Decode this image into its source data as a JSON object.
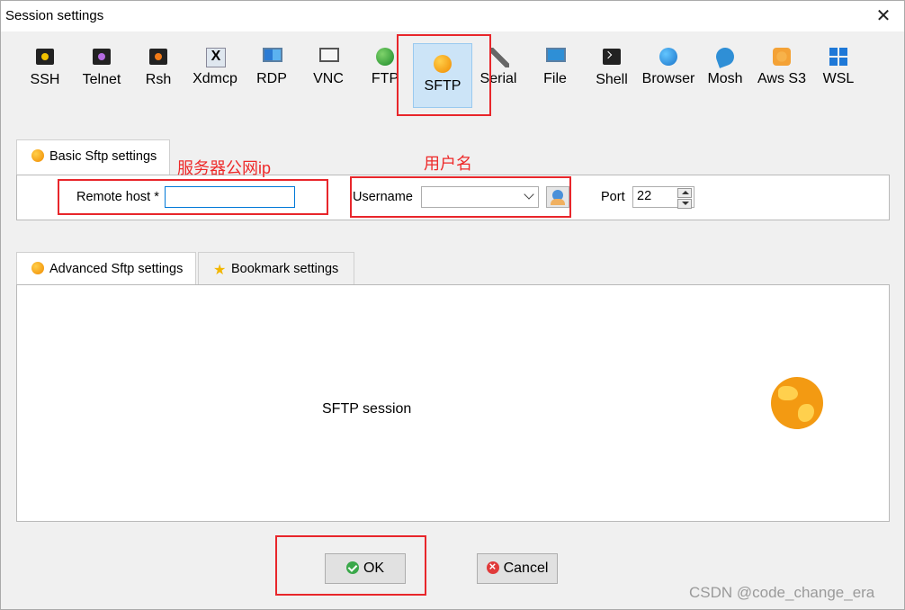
{
  "window": {
    "title": "Session settings",
    "close_symbol": "✕"
  },
  "protocols": [
    {
      "label": "SSH",
      "icon": "ssh-icon"
    },
    {
      "label": "Telnet",
      "icon": "telnet-icon"
    },
    {
      "label": "Rsh",
      "icon": "rsh-icon"
    },
    {
      "label": "Xdmcp",
      "icon": "xdmcp-icon"
    },
    {
      "label": "RDP",
      "icon": "rdp-icon"
    },
    {
      "label": "VNC",
      "icon": "vnc-icon"
    },
    {
      "label": "FTP",
      "icon": "ftp-icon"
    },
    {
      "label": "SFTP",
      "icon": "sftp-icon",
      "selected": true
    },
    {
      "label": "Serial",
      "icon": "serial-icon"
    },
    {
      "label": "File",
      "icon": "file-icon"
    },
    {
      "label": "Shell",
      "icon": "shell-icon"
    },
    {
      "label": "Browser",
      "icon": "browser-icon"
    },
    {
      "label": "Mosh",
      "icon": "mosh-icon"
    },
    {
      "label": "Aws S3",
      "icon": "aws-s3-icon"
    },
    {
      "label": "WSL",
      "icon": "wsl-icon"
    }
  ],
  "annotations": {
    "server_ip": "服务器公网ip",
    "username": "用户名"
  },
  "basic_tab": {
    "label": "Basic Sftp settings",
    "remote_host_label": "Remote host *",
    "remote_host_value": "",
    "username_label": "Username",
    "username_value": "",
    "port_label": "Port",
    "port_value": "22"
  },
  "lower_tabs": {
    "advanced": "Advanced Sftp settings",
    "bookmark": "Bookmark settings"
  },
  "session_panel": {
    "text": "SFTP session"
  },
  "buttons": {
    "ok": "OK",
    "cancel": "Cancel"
  },
  "watermark": "CSDN @code_change_era",
  "colors": {
    "annotation_red": "#e8262b",
    "selected_tab_bg": "#cce4f7",
    "focus_border": "#0078d7"
  }
}
